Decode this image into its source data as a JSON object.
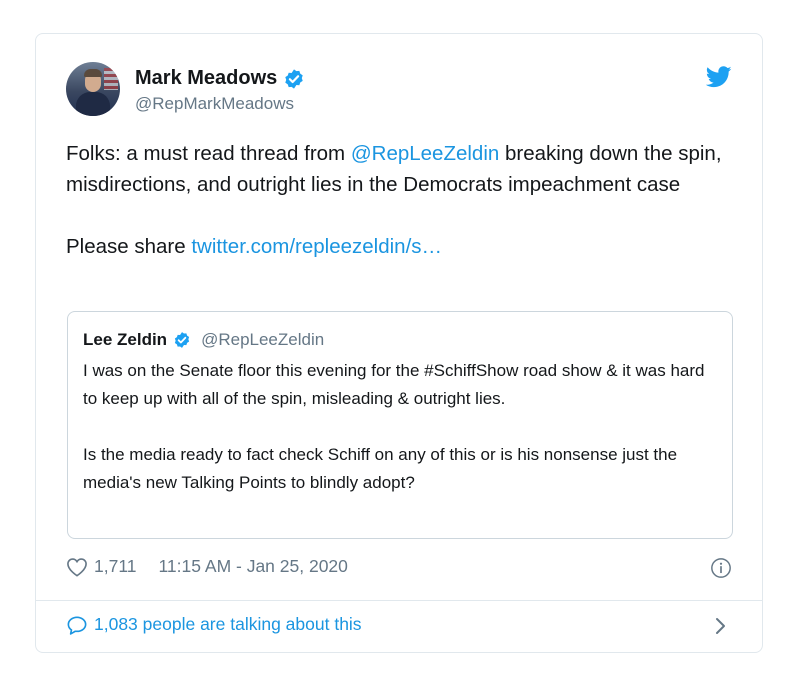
{
  "tweet": {
    "author_name": "Mark Meadows",
    "author_handle": "@RepMarkMeadows",
    "text_before_mention": "Folks: a must read thread from ",
    "mention": "@RepLeeZeldin",
    "text_after_mention": " breaking down the spin, misdirections, and outright lies in the Democrats impeachment case",
    "share_text": "Please share ",
    "share_link": "twitter.com/repleezeldin/s…",
    "likes": "1,711",
    "timestamp": "11:15 AM - Jan 25, 2020",
    "talking_text": "1,083 people are talking about this"
  },
  "quoted": {
    "author_name": "Lee Zeldin",
    "author_handle": "@RepLeeZeldin",
    "paragraph1": "I was on the Senate floor this evening for the #SchiffShow road show & it was hard to keep up with all of the spin, misleading & outright lies.",
    "paragraph2": "Is the media ready to fact check Schiff on any of this or is his nonsense just the media's new Talking Points to blindly adopt?"
  },
  "icons": {
    "verified": "verified-badge-icon",
    "logo": "twitter-bird-icon",
    "like": "heart-icon",
    "info": "info-icon",
    "reply": "speech-bubble-icon",
    "more": "chevron-right-icon"
  },
  "colors": {
    "link": "#1b95e0",
    "secondary": "#657786",
    "border": "#e1e8ed",
    "text": "#14171a"
  }
}
